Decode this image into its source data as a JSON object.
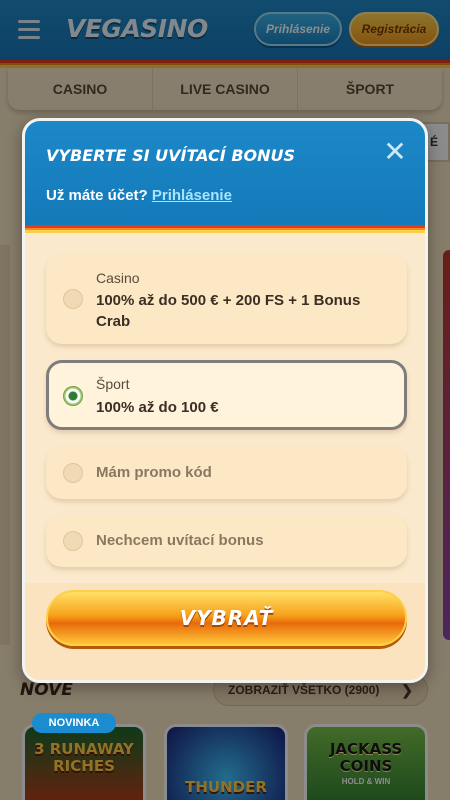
{
  "header": {
    "logo": "VEGASINO",
    "login_label": "Prihlásenie",
    "register_label": "Registrácia"
  },
  "nav": {
    "tabs": [
      {
        "label": "CASINO"
      },
      {
        "label": "LIVE CASINO"
      },
      {
        "label": "ŠPORT"
      }
    ]
  },
  "background": {
    "pill_text": "É",
    "section_title": "NOVÉ",
    "show_all_label": "ZOBRAZIŤ VŠETKO (2900)",
    "games": [
      {
        "badge": "NOVINKA",
        "title": "3 RUNAWAY RICHES",
        "subtitle": ""
      },
      {
        "badge": "",
        "title": "THUNDER",
        "subtitle": ""
      },
      {
        "badge": "",
        "title": "JACKASS COINS",
        "subtitle": "HOLD & WIN"
      }
    ]
  },
  "modal": {
    "title": "VYBERTE SI UVÍTACÍ BONUS",
    "subtitle_text": "Už máte účet?",
    "subtitle_link": "Prihlásenie",
    "options": [
      {
        "label": "Casino",
        "value": "100% až do 500 € + 200 FS + 1 Bonus Crab",
        "selected": false
      },
      {
        "label": "Šport",
        "value": "100% až do 100 €",
        "selected": true
      },
      {
        "label": "Mám promo kód",
        "selected": false
      },
      {
        "label": "Nechcem uvítací bonus",
        "selected": false
      }
    ],
    "select_button": "VYBRAŤ"
  },
  "colors": {
    "header_blue": "#1778b8",
    "accent_orange": "#f29b1c",
    "panel_cream": "#fbe9cd"
  }
}
